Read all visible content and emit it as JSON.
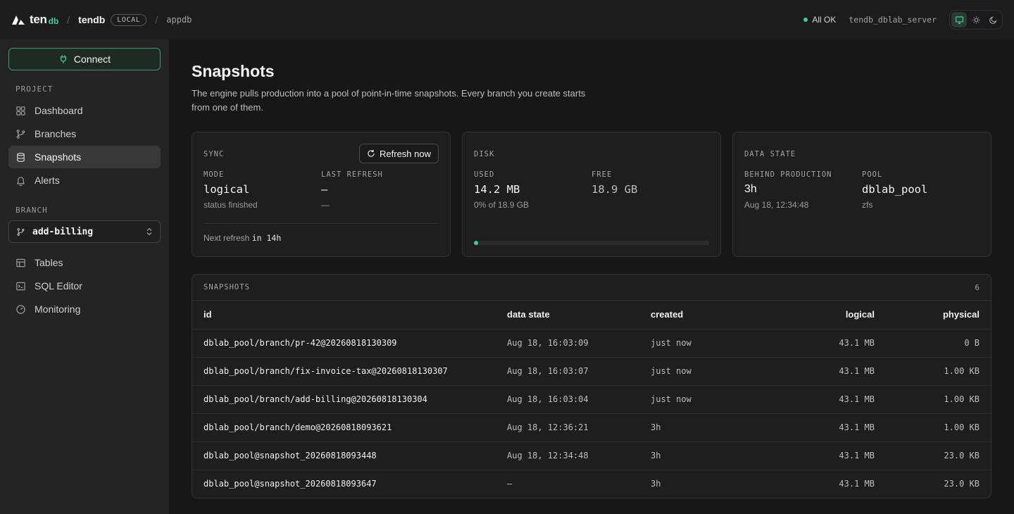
{
  "topbar": {
    "logo_text": "ten",
    "logo_sub": "db",
    "project": "tendb",
    "env_badge": "LOCAL",
    "database": "appdb",
    "status": "All OK",
    "server": "tendb_dblab_server",
    "theme_icons": [
      "monitor-icon",
      "sun-icon",
      "moon-icon"
    ]
  },
  "sidebar": {
    "connect_label": "Connect",
    "project_label": "PROJECT",
    "project_items": [
      {
        "label": "Dashboard",
        "icon": "grid-icon"
      },
      {
        "label": "Branches",
        "icon": "git-branch-icon"
      },
      {
        "label": "Snapshots",
        "icon": "database-icon",
        "active": true
      },
      {
        "label": "Alerts",
        "icon": "bell-icon"
      }
    ],
    "branch_label": "BRANCH",
    "branch_value": "add-billing",
    "branch_items": [
      {
        "label": "Tables",
        "icon": "table-icon"
      },
      {
        "label": "SQL Editor",
        "icon": "terminal-icon"
      },
      {
        "label": "Monitoring",
        "icon": "gauge-icon"
      }
    ]
  },
  "page": {
    "title": "Snapshots",
    "description": "The engine pulls production into a pool of point-in-time snapshots. Every branch you create starts from one of them."
  },
  "sync": {
    "label": "SYNC",
    "refresh_button": "Refresh now",
    "mode_label": "MODE",
    "mode_value": "logical",
    "mode_sub": "status finished",
    "last_refresh_label": "LAST REFRESH",
    "last_refresh_value": "—",
    "last_refresh_sub": "—",
    "next_refresh_prefix": "Next refresh",
    "next_refresh_value": "in 14h"
  },
  "disk": {
    "label": "DISK",
    "used_label": "USED",
    "used_value": "14.2 MB",
    "used_sub": "0% of 18.9 GB",
    "free_label": "FREE",
    "free_value": "18.9 GB",
    "usage_fraction": 0.0
  },
  "data_state": {
    "label": "DATA STATE",
    "behind_label": "BEHIND PRODUCTION",
    "behind_value": "3h",
    "behind_sub": "Aug 18, 12:34:48",
    "pool_label": "POOL",
    "pool_value": "dblab_pool",
    "pool_sub": "zfs"
  },
  "snapshots": {
    "label": "SNAPSHOTS",
    "count": "6",
    "columns": [
      "id",
      "data state",
      "created",
      "logical",
      "physical"
    ],
    "rows": [
      [
        "dblab_pool/branch/pr-42@20260818130309",
        "Aug 18, 16:03:09",
        "just now",
        "43.1 MB",
        "0 B"
      ],
      [
        "dblab_pool/branch/fix-invoice-tax@20260818130307",
        "Aug 18, 16:03:07",
        "just now",
        "43.1 MB",
        "1.00 KB"
      ],
      [
        "dblab_pool/branch/add-billing@20260818130304",
        "Aug 18, 16:03:04",
        "just now",
        "43.1 MB",
        "1.00 KB"
      ],
      [
        "dblab_pool/branch/demo@20260818093621",
        "Aug 18, 12:36:21",
        "3h",
        "43.1 MB",
        "1.00 KB"
      ],
      [
        "dblab_pool@snapshot_20260818093448",
        "Aug 18, 12:34:48",
        "3h",
        "43.1 MB",
        "23.0 KB"
      ],
      [
        "dblab_pool@snapshot_20260818093647",
        "—",
        "3h",
        "43.1 MB",
        "23.0 KB"
      ]
    ]
  },
  "colors": {
    "accent": "#34d399",
    "background": "#171717",
    "sidebar": "#242424",
    "card": "#1e1e1e"
  }
}
